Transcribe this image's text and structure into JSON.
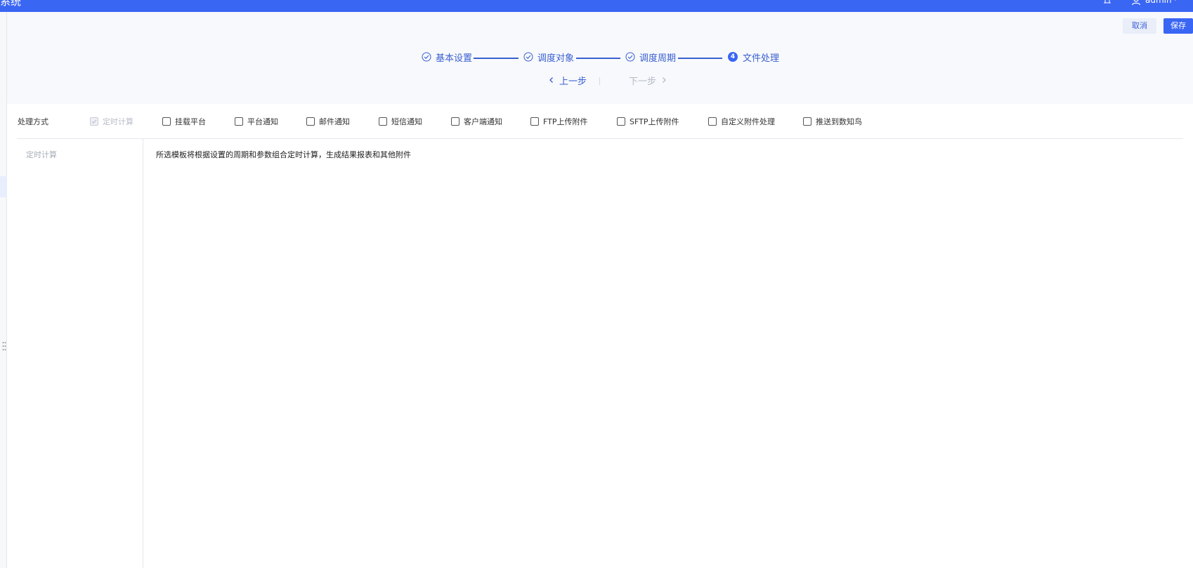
{
  "topbar": {
    "app_title": "系统",
    "user_name": "admin"
  },
  "toolbar": {
    "cancel_label": "取消",
    "save_label": "保存"
  },
  "steps": [
    {
      "label": "基本设置",
      "state": "done"
    },
    {
      "label": "调度对象",
      "state": "done"
    },
    {
      "label": "调度周期",
      "state": "done"
    },
    {
      "label": "文件处理",
      "state": "current",
      "number": "4"
    }
  ],
  "nav": {
    "prev_label": "上一步",
    "next_label": "下一步"
  },
  "options": {
    "label": "处理方式",
    "items": [
      {
        "label": "定时计算",
        "checked": true,
        "disabled": true
      },
      {
        "label": "挂载平台",
        "checked": false
      },
      {
        "label": "平台通知",
        "checked": false
      },
      {
        "label": "邮件通知",
        "checked": false
      },
      {
        "label": "短信通知",
        "checked": false
      },
      {
        "label": "客户端通知",
        "checked": false
      },
      {
        "label": "FTP上传附件",
        "checked": false
      },
      {
        "label": "SFTP上传附件",
        "checked": false
      },
      {
        "label": "自定义附件处理",
        "checked": false
      },
      {
        "label": "推送到数知鸟",
        "checked": false
      }
    ]
  },
  "side_list": {
    "items": [
      "定时计算"
    ]
  },
  "description": "所选模板将根据设置的周期和参数组合定时计算，生成结果报表和其他附件",
  "colors": {
    "primary": "#3a66f4",
    "step_text": "#3a5fd0",
    "disabled_text": "#b5bbc7"
  }
}
